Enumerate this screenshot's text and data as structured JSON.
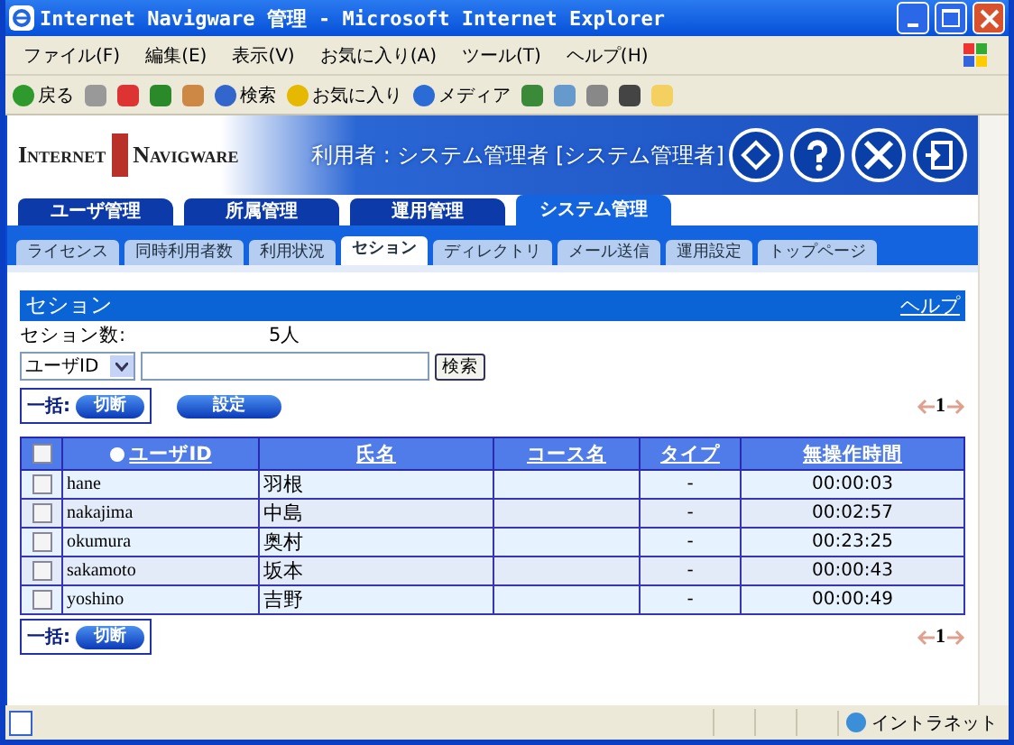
{
  "window": {
    "title": "Internet Navigware 管理 - Microsoft Internet Explorer"
  },
  "menu": [
    "ファイル(F)",
    "編集(E)",
    "表示(V)",
    "お気に入り(A)",
    "ツール(T)",
    "ヘルプ(H)"
  ],
  "toolbar": [
    {
      "kind": "back",
      "label": "戻る"
    },
    {
      "kind": "forward"
    },
    {
      "kind": "stop"
    },
    {
      "kind": "refresh"
    },
    {
      "kind": "home"
    },
    {
      "kind": "search",
      "label": "検索"
    },
    {
      "kind": "favorites",
      "label": "お気に入り"
    },
    {
      "kind": "media",
      "label": "メディア"
    },
    {
      "kind": "history"
    },
    {
      "kind": "mail"
    },
    {
      "kind": "print"
    },
    {
      "kind": "edit"
    },
    {
      "kind": "note"
    }
  ],
  "header": {
    "logo_left": "Internet",
    "logo_right": "Navigware",
    "user": "利用者 : システム管理者 [システム管理者]"
  },
  "main_tabs": [
    {
      "label": "ユーザ管理",
      "selected": false
    },
    {
      "label": "所属管理",
      "selected": false
    },
    {
      "label": "運用管理",
      "selected": false
    },
    {
      "label": "システム管理",
      "selected": true
    }
  ],
  "sub_tabs": [
    {
      "label": "ライセンス",
      "selected": false
    },
    {
      "label": "同時利用者数",
      "selected": false
    },
    {
      "label": "利用状況",
      "selected": false
    },
    {
      "label": "セション",
      "selected": true
    },
    {
      "label": "ディレクトリ",
      "selected": false
    },
    {
      "label": "メール送信",
      "selected": false
    },
    {
      "label": "運用設定",
      "selected": false
    },
    {
      "label": "トップページ",
      "selected": false
    }
  ],
  "section": {
    "title": "セション",
    "help": "ヘルプ"
  },
  "count": {
    "label": "セション数:",
    "value": "5人"
  },
  "search": {
    "field": "ユーザID",
    "button": "検索"
  },
  "bulk": {
    "label": "一括:",
    "button": "切断"
  },
  "settings_button": "設定",
  "pager": {
    "page": "1"
  },
  "table": {
    "select_all_checked": false,
    "columns": [
      "ユーザID",
      "氏名",
      "コース名",
      "タイプ",
      "無操作時間"
    ],
    "rows": [
      {
        "checked": false,
        "cells": [
          "hane",
          "羽根",
          "",
          "-",
          "00:00:03"
        ]
      },
      {
        "checked": false,
        "cells": [
          "nakajima",
          "中島",
          "",
          "-",
          "00:02:57"
        ]
      },
      {
        "checked": false,
        "cells": [
          "okumura",
          "奥村",
          "",
          "-",
          "00:23:25"
        ]
      },
      {
        "checked": false,
        "cells": [
          "sakamoto",
          "坂本",
          "",
          "-",
          "00:00:43"
        ]
      },
      {
        "checked": false,
        "cells": [
          "yoshino",
          "吉野",
          "",
          "-",
          "00:00:49"
        ]
      }
    ]
  },
  "bottom_bulk": {
    "label": "一括:",
    "button": "切断"
  },
  "bottom_pager": {
    "page": "1"
  },
  "status_bar": {
    "zone": "イントラネット"
  }
}
